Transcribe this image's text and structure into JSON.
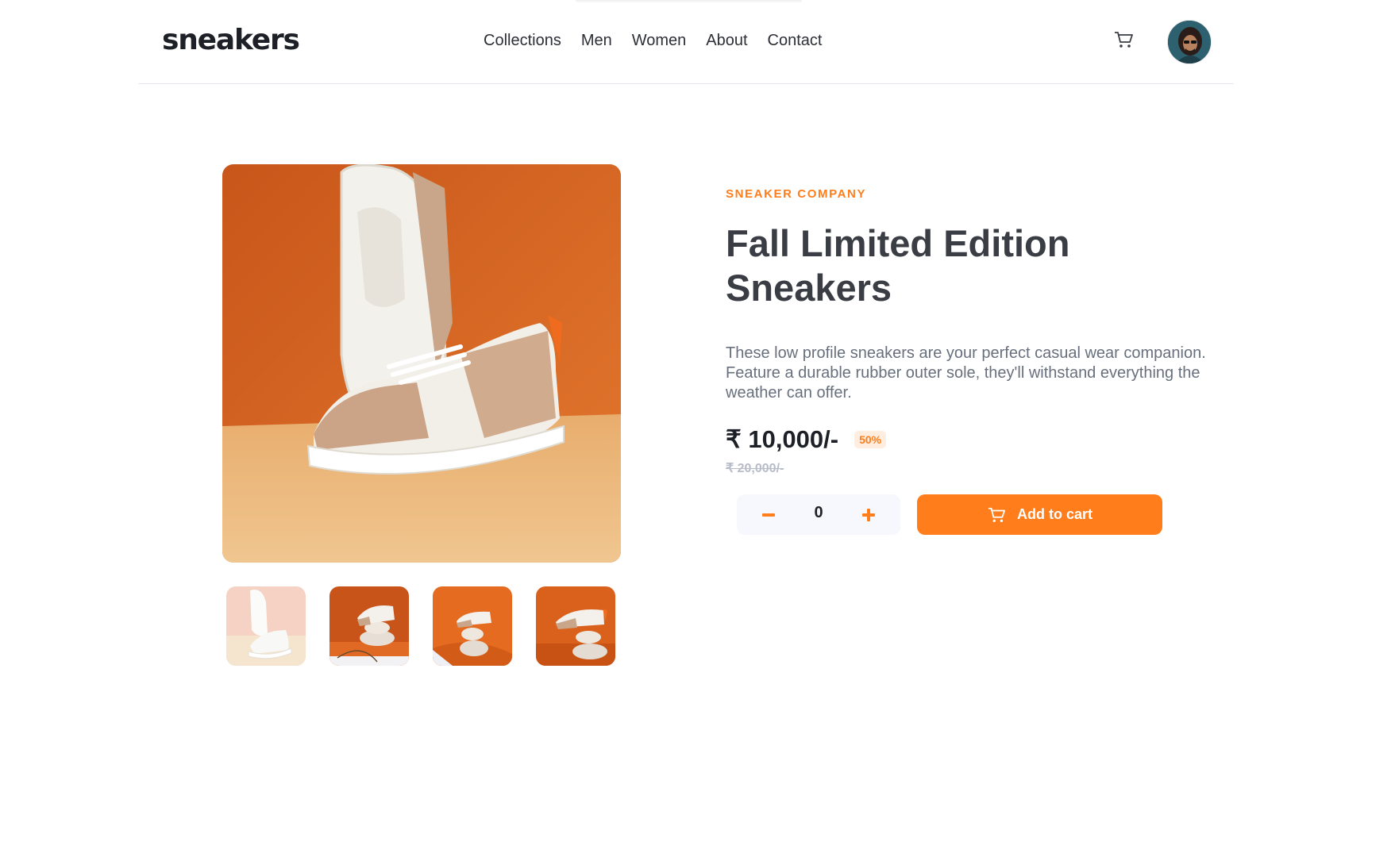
{
  "header": {
    "logo": "sneakers",
    "nav": [
      "Collections",
      "Men",
      "Women",
      "About",
      "Contact"
    ],
    "cart_icon": "cart-icon",
    "avatar_icon": "avatar"
  },
  "gallery": {
    "main_alt": "sneaker-main-image",
    "thumbnails": [
      "thumbnail-1",
      "thumbnail-2",
      "thumbnail-3",
      "thumbnail-4"
    ]
  },
  "product": {
    "company": "SNEAKER COMPANY",
    "title": "Fall Limited Edition Sneakers",
    "description": "These low profile sneakers are your perfect casual wear companion. Feature a durable rubber outer sole, they'll withstand everything the weather can offer.",
    "price": "₹ 10,000/-",
    "discount": "50%",
    "old_price": "₹ 20,000/-"
  },
  "cart_controls": {
    "quantity": "0",
    "add_label": "Add to cart"
  },
  "colors": {
    "accent": "#ff7e1b",
    "accent_pale": "#ffede0",
    "heading": "#3a3d44",
    "body_text": "#68707d",
    "muted": "#b6bcc8"
  }
}
